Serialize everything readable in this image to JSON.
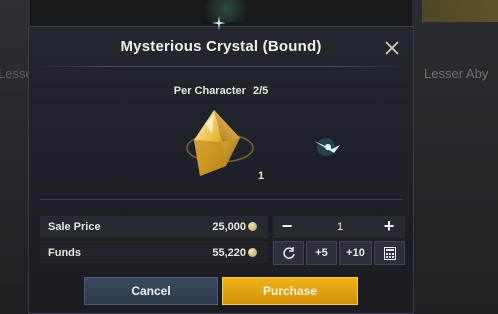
{
  "background": {
    "left_text": "Lesser",
    "right_text": "Lesser Aby"
  },
  "dialog": {
    "title": "Mysterious Crystal (Bound)",
    "limit_label": "Per Character",
    "limit_value": "2/5",
    "item_quantity": "1",
    "close_icon": "close-icon"
  },
  "pricing": {
    "sale_price_label": "Sale Price",
    "sale_price_value": "25,000",
    "funds_label": "Funds",
    "funds_value": "55,220",
    "currency_icon": "coin-icon"
  },
  "quantity": {
    "value": "1",
    "minus_label": "−",
    "plus_label": "+",
    "plus5_label": "+5",
    "plus10_label": "+10"
  },
  "buttons": {
    "cancel": "Cancel",
    "purchase": "Purchase"
  },
  "colors": {
    "purchase_accent": "#e2a212",
    "cancel_bg": "#334457",
    "dialog_bg": "#1f2228"
  }
}
